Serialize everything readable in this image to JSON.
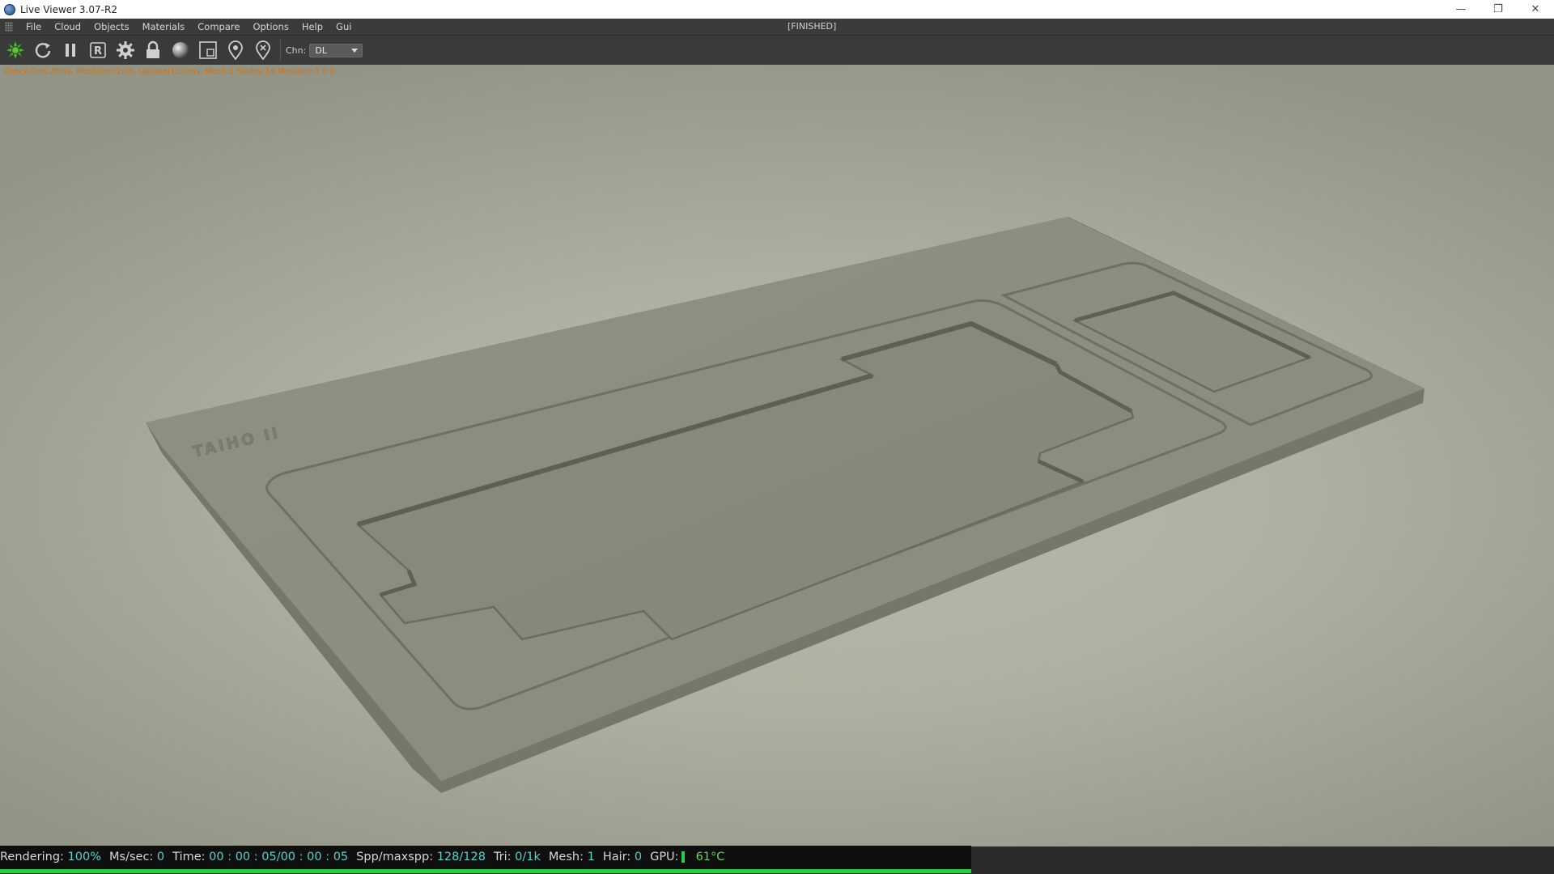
{
  "window": {
    "title": "Live Viewer 3.07-R2",
    "controls": {
      "minimize": "—",
      "restore": "❐",
      "close": "✕"
    }
  },
  "menu": {
    "items": [
      "File",
      "Cloud",
      "Objects",
      "Materials",
      "Compare",
      "Options",
      "Help",
      "Gui"
    ],
    "render_state": "[FINISHED]"
  },
  "toolbar": {
    "icons": [
      "render-icon",
      "restart-icon",
      "pause-icon",
      "region-render-icon",
      "settings-icon",
      "lock-icon",
      "material-sphere-icon",
      "viewport-icon",
      "pick-focus-icon",
      "pick-material-icon"
    ],
    "region_glyph": "R",
    "channel_label": "Chn:",
    "channel_value": "DL"
  },
  "viewport": {
    "check_line": "Check:0ms./5ms. MeshGen:2ms. Update[C]:0ms. Mesh:1 Nodes:14 Movable:1  0 0",
    "engraving": "TAIHO II"
  },
  "status": {
    "rendering_label": "Rendering:",
    "rendering_value": "100%",
    "mssec_label": "Ms/sec:",
    "mssec_value": "0",
    "time_label": "Time:",
    "time_value": "00 : 00 : 05/00 : 00 : 05",
    "spp_label": "Spp/maxspp:",
    "spp_value": "128/128",
    "tri_label": "Tri:",
    "tri_value": "0/1k",
    "mesh_label": "Mesh:",
    "mesh_value": "1",
    "hair_label": "Hair:",
    "hair_value": "0",
    "gpu_label": "GPU:",
    "gpu_temp": "61°C",
    "progress_fraction": 1.0
  },
  "colors": {
    "accent_value": "#4fd7c8",
    "progress": "#2ecc40",
    "check_text": "#c8741f"
  }
}
